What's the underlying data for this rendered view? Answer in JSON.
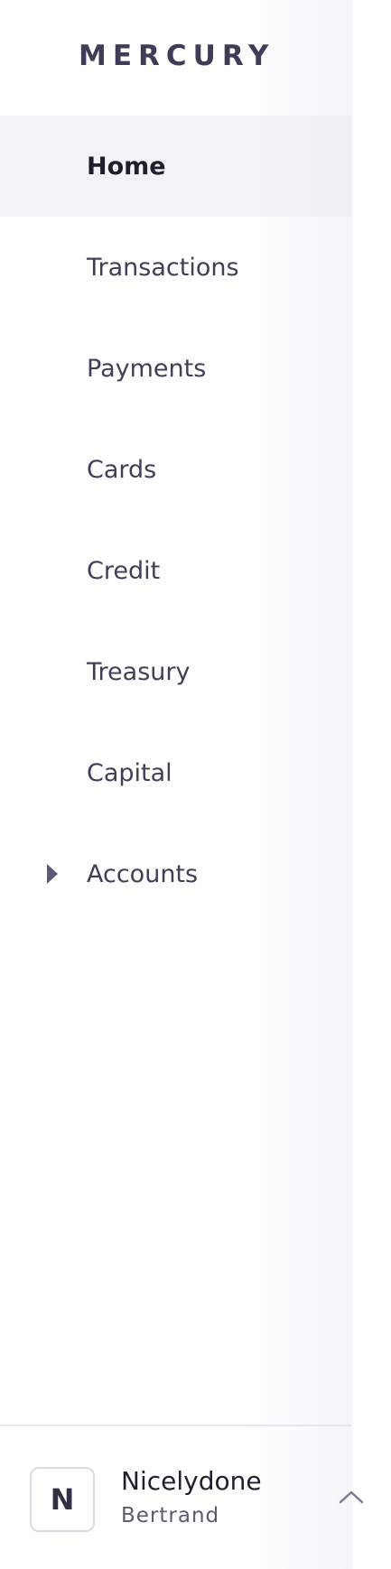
{
  "sidebar": {
    "logo": "MERCURY",
    "nav": [
      {
        "label": "Home",
        "active": true
      },
      {
        "label": "Transactions"
      },
      {
        "label": "Payments"
      },
      {
        "label": "Cards"
      },
      {
        "label": "Credit"
      },
      {
        "label": "Treasury"
      },
      {
        "label": "Capital"
      },
      {
        "label": "Accounts",
        "expandable": true
      }
    ]
  },
  "footer": {
    "avatar_initial": "N",
    "org_name": "Nicelydone",
    "user_name": "Bertrand",
    "chevron_icon": "chevron-up-icon"
  }
}
